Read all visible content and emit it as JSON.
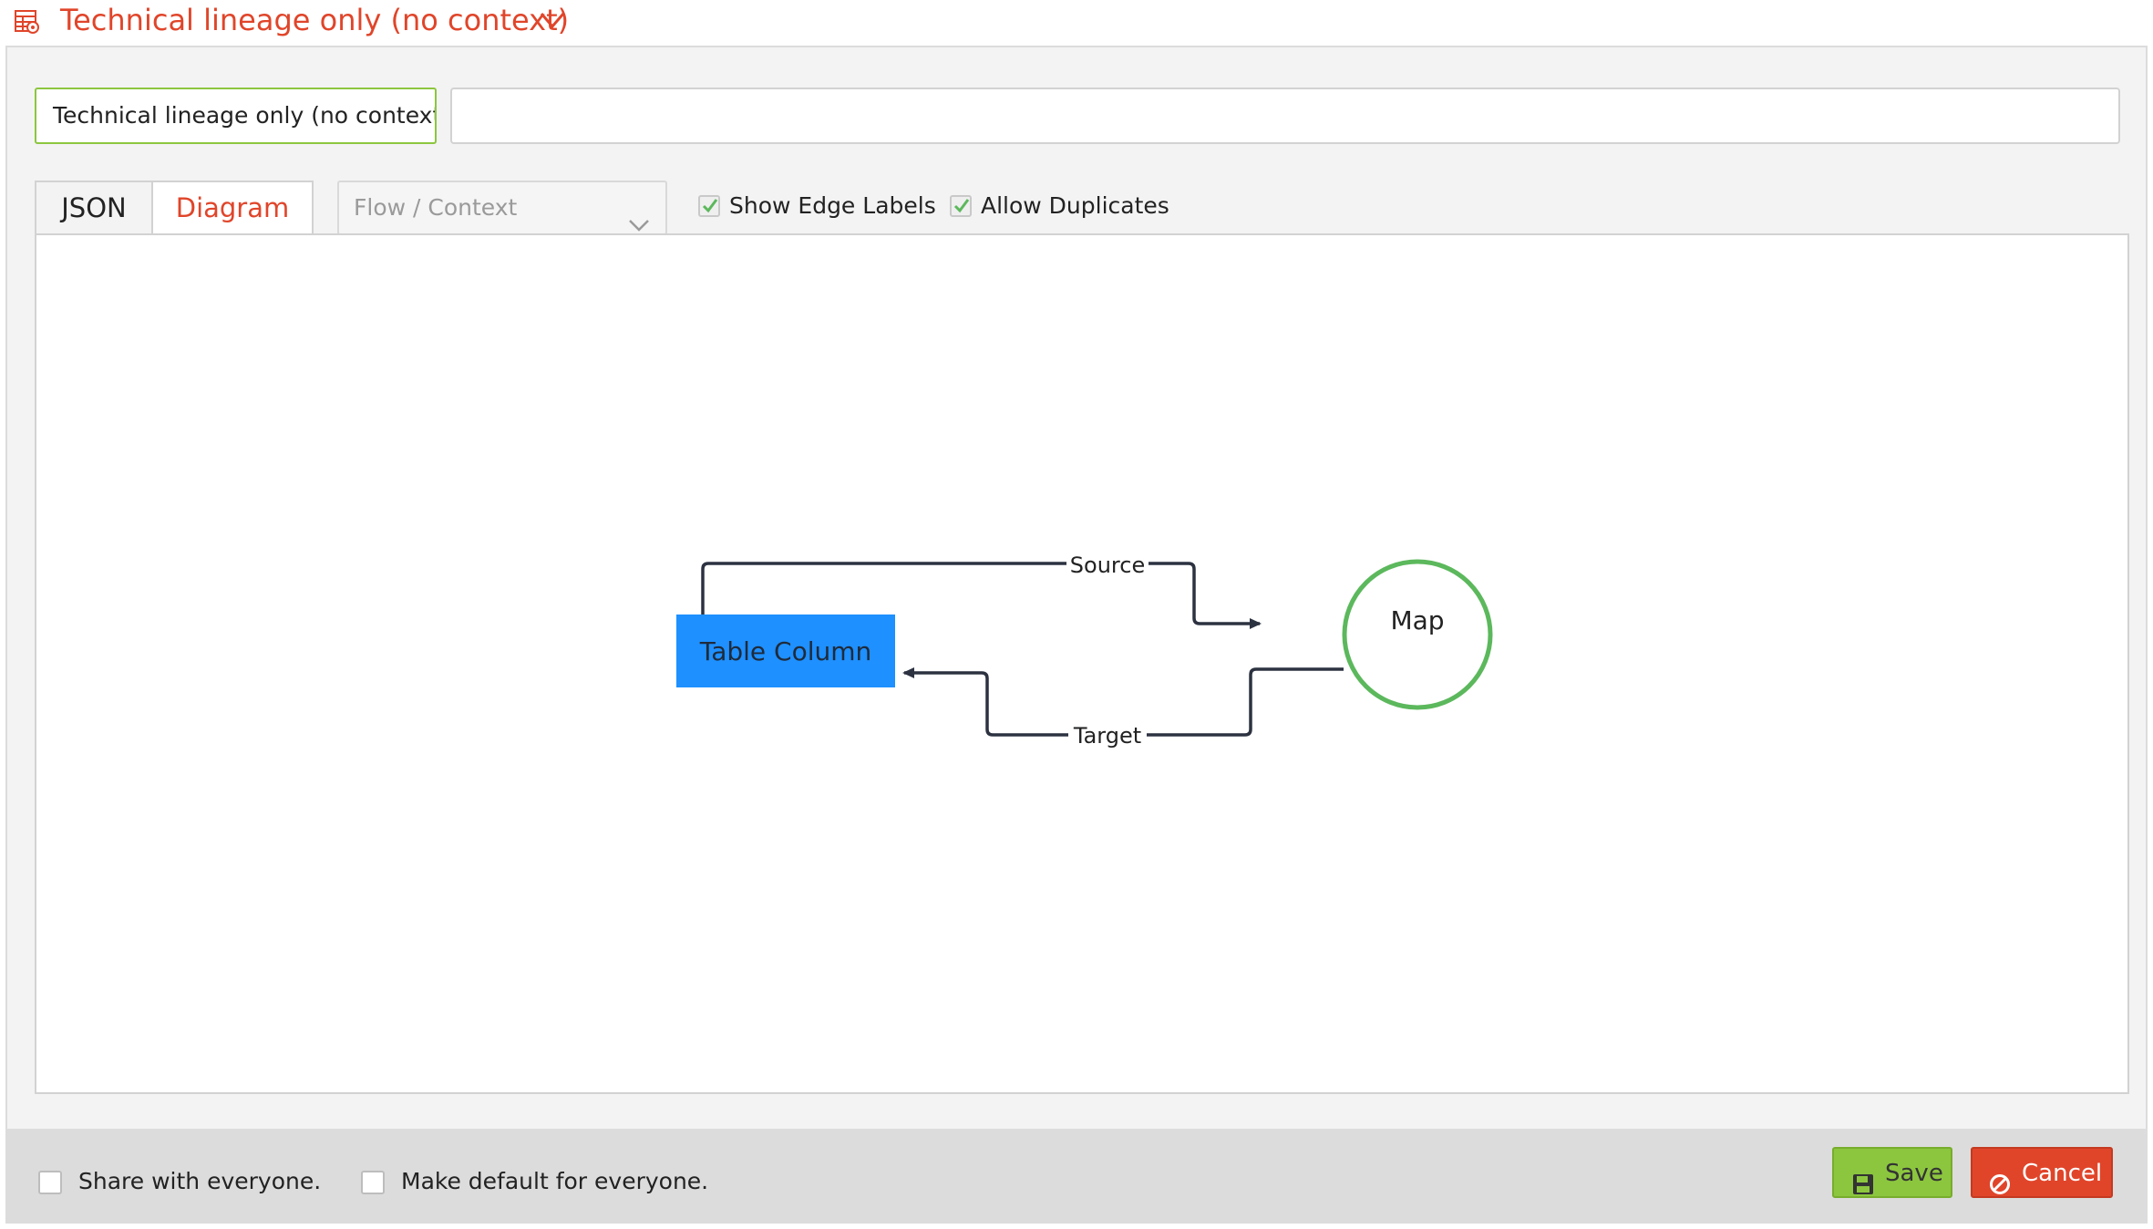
{
  "header": {
    "view_icon": "table-view-icon",
    "title": "Technical lineage only (no context)",
    "dropdown_icon": "chevron-down-icon"
  },
  "form": {
    "name_value": "Technical lineage only (no context",
    "description_value": ""
  },
  "tabs": [
    {
      "label": "JSON",
      "active": false
    },
    {
      "label": "Diagram",
      "active": true
    }
  ],
  "mode_select": {
    "selected": "Flow / Context",
    "arrow_icon": "chevron-down-icon"
  },
  "options": {
    "show_edge_labels": {
      "label": "Show Edge Labels",
      "checked": true
    },
    "allow_duplicates": {
      "label": "Allow Duplicates",
      "checked": true
    }
  },
  "diagram": {
    "nodes": [
      {
        "id": "table-column",
        "label": "Table Column",
        "shape": "rectangle",
        "fill": "#1e90ff"
      },
      {
        "id": "map",
        "label": "Map",
        "shape": "circle",
        "stroke": "#5cb85c"
      }
    ],
    "edges": [
      {
        "from": "table-column",
        "to": "map",
        "label": "Source"
      },
      {
        "from": "map",
        "to": "table-column",
        "label": "Target"
      }
    ]
  },
  "footer": {
    "share_label": "Share with everyone.",
    "share_checked": false,
    "default_label": "Make default for everyone.",
    "default_checked": false,
    "save_label": "Save",
    "save_icon": "floppy-disk-icon",
    "cancel_label": "Cancel",
    "cancel_icon": "ban-icon"
  },
  "colors": {
    "accent": "#e0452a",
    "save": "#8cc63f",
    "node_rect": "#1e90ff",
    "node_circle": "#5cb85c"
  }
}
